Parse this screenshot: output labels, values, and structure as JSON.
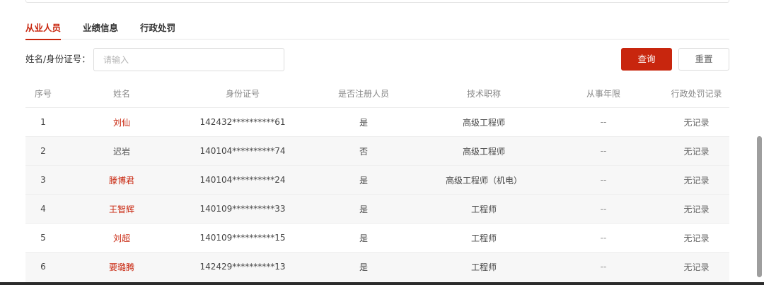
{
  "tabs": [
    {
      "label": "从业人员",
      "active": true
    },
    {
      "label": "业绩信息",
      "active": false
    },
    {
      "label": "行政处罚",
      "active": false
    }
  ],
  "search": {
    "label": "姓名/身份证号：",
    "placeholder": "请输入",
    "query_label": "查询",
    "reset_label": "重置"
  },
  "table": {
    "headers": [
      "序号",
      "姓名",
      "身份证号",
      "是否注册人员",
      "技术职称",
      "从事年限",
      "行政处罚记录"
    ],
    "rows": [
      {
        "index": "1",
        "name": "刘仙",
        "id": "142432**********61",
        "registered": "是",
        "title": "高级工程师",
        "years": "--",
        "record": "无记录"
      },
      {
        "index": "2",
        "name": "迟岩",
        "id": "140104**********74",
        "registered": "否",
        "title": "高级工程师",
        "years": "--",
        "record": "无记录"
      },
      {
        "index": "3",
        "name": "滕博君",
        "id": "140104**********24",
        "registered": "是",
        "title": "高级工程师（机电）",
        "years": "--",
        "record": "无记录"
      },
      {
        "index": "4",
        "name": "王智辉",
        "id": "140109**********33",
        "registered": "是",
        "title": "工程师",
        "years": "--",
        "record": "无记录"
      },
      {
        "index": "5",
        "name": "刘超",
        "id": "140109**********15",
        "registered": "是",
        "title": "工程师",
        "years": "--",
        "record": "无记录"
      },
      {
        "index": "6",
        "name": "要璐腾",
        "id": "142429**********13",
        "registered": "是",
        "title": "工程师",
        "years": "--",
        "record": "无记录"
      }
    ]
  },
  "colors": {
    "accent": "#c8260e",
    "row_shade": "#f7f7f7"
  }
}
